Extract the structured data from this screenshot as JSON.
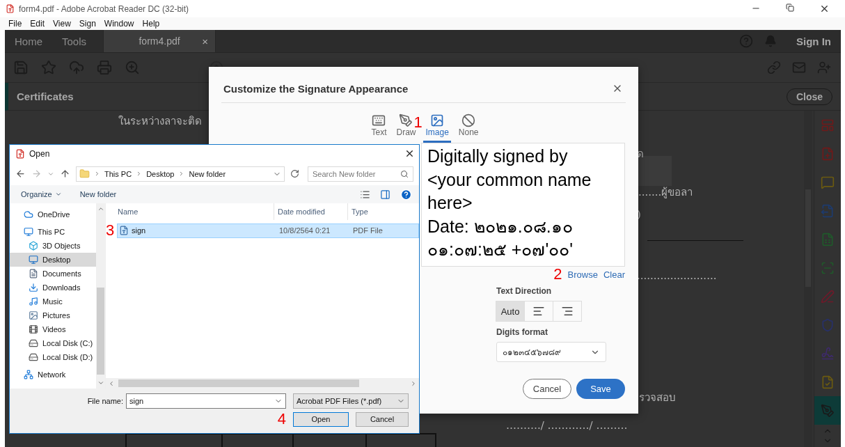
{
  "window": {
    "title": "form4.pdf - Adobe Acrobat Reader DC (32-bit)"
  },
  "menu": [
    "File",
    "Edit",
    "View",
    "Sign",
    "Window",
    "Help"
  ],
  "app_tabs": [
    {
      "label": "Home",
      "selected": false,
      "kind": "nav"
    },
    {
      "label": "Tools",
      "selected": false,
      "kind": "nav"
    },
    {
      "label": "form4.pdf",
      "selected": true,
      "kind": "document",
      "close": "×"
    }
  ],
  "account": {
    "sign_in": "Sign In"
  },
  "panel": {
    "title": "Certificates",
    "close": "Close"
  },
  "document": {
    "texts": [
      "ในระหว่างลาจะติด",
      "ด",
      ".......ผู้ขอลา",
      ")",
      "........................",
      "รวจสอบ",
      "………./ …………/ ………"
    ]
  },
  "tools_sidebar": [
    {
      "kind": "layout",
      "selected": false
    },
    {
      "kind": "file-plus",
      "selected": false
    },
    {
      "kind": "comment",
      "selected": false
    },
    {
      "kind": "export",
      "selected": false
    },
    {
      "kind": "sheet",
      "selected": false
    },
    {
      "kind": "scan",
      "selected": false
    },
    {
      "kind": "pen-red",
      "selected": false
    },
    {
      "kind": "shield",
      "selected": false
    },
    {
      "kind": "pen-purple",
      "selected": false
    },
    {
      "kind": "file-note",
      "selected": false
    },
    {
      "kind": "cert-pen",
      "selected": true
    }
  ],
  "signature_dialog": {
    "title": "Customize the Signature Appearance",
    "modes": [
      {
        "kind": "text",
        "label": "Text",
        "selected": false
      },
      {
        "kind": "draw",
        "label": "Draw",
        "selected": false
      },
      {
        "kind": "image",
        "label": "Image",
        "selected": true,
        "step_marker": "1"
      },
      {
        "kind": "none",
        "label": "None",
        "selected": false
      }
    ],
    "preview": {
      "lines": [
        "Digitally signed by",
        "<your common name",
        "here>",
        "Date: ๒๐๒๑.๐๘.๑๐",
        "๐๑:๐๗:๒๕ +๐๗'๐๐'"
      ]
    },
    "links": {
      "step_marker": "2",
      "browse": "Browse",
      "clear": "Clear"
    },
    "text_direction": {
      "label": "Text Direction",
      "options": [
        {
          "kind": "text",
          "label": "Auto",
          "selected": true
        },
        {
          "kind": "align-left",
          "selected": false
        },
        {
          "kind": "align-right",
          "selected": false
        }
      ]
    },
    "digits_format": {
      "label": "Digits format",
      "value": "๐๑๒๓๔๕๖๗๘๙"
    },
    "buttons": {
      "cancel": "Cancel",
      "save": "Save"
    }
  },
  "open_dialog": {
    "title": "Open",
    "breadcrumb": [
      "This PC",
      "Desktop",
      "New folder"
    ],
    "search": {
      "placeholder": "Search New folder"
    },
    "commands": {
      "organize": "Organize",
      "new_folder": "New folder"
    },
    "nav": [
      {
        "kind": "cloud",
        "label": "OneDrive",
        "selected": false
      },
      {
        "kind": "pc",
        "label": "This PC",
        "selected": false,
        "children": [
          {
            "kind": "cube",
            "label": "3D Objects",
            "selected": false
          },
          {
            "kind": "desktop",
            "label": "Desktop",
            "selected": true
          },
          {
            "kind": "documents",
            "label": "Documents",
            "selected": false
          },
          {
            "kind": "downloads",
            "label": "Downloads",
            "selected": false
          },
          {
            "kind": "music",
            "label": "Music",
            "selected": false
          },
          {
            "kind": "pictures",
            "label": "Pictures",
            "selected": false
          },
          {
            "kind": "videos",
            "label": "Videos",
            "selected": false
          },
          {
            "kind": "disk",
            "label": "Local Disk (C:)",
            "selected": false
          },
          {
            "kind": "disk",
            "label": "Local Disk (D:)",
            "selected": false
          }
        ]
      },
      {
        "kind": "network",
        "label": "Network",
        "selected": false
      }
    ],
    "columns": [
      "Name",
      "Date modified",
      "Type"
    ],
    "files": [
      {
        "name": "sign",
        "date": "10/8/2564 0:21",
        "type": "PDF File",
        "selected": true,
        "step_marker": "3"
      }
    ],
    "file_name": {
      "label": "File name:",
      "value": "sign"
    },
    "file_type": "Acrobat PDF Files (*.pdf)",
    "buttons": {
      "step_marker": "4",
      "open": "Open",
      "cancel": "Cancel"
    }
  }
}
